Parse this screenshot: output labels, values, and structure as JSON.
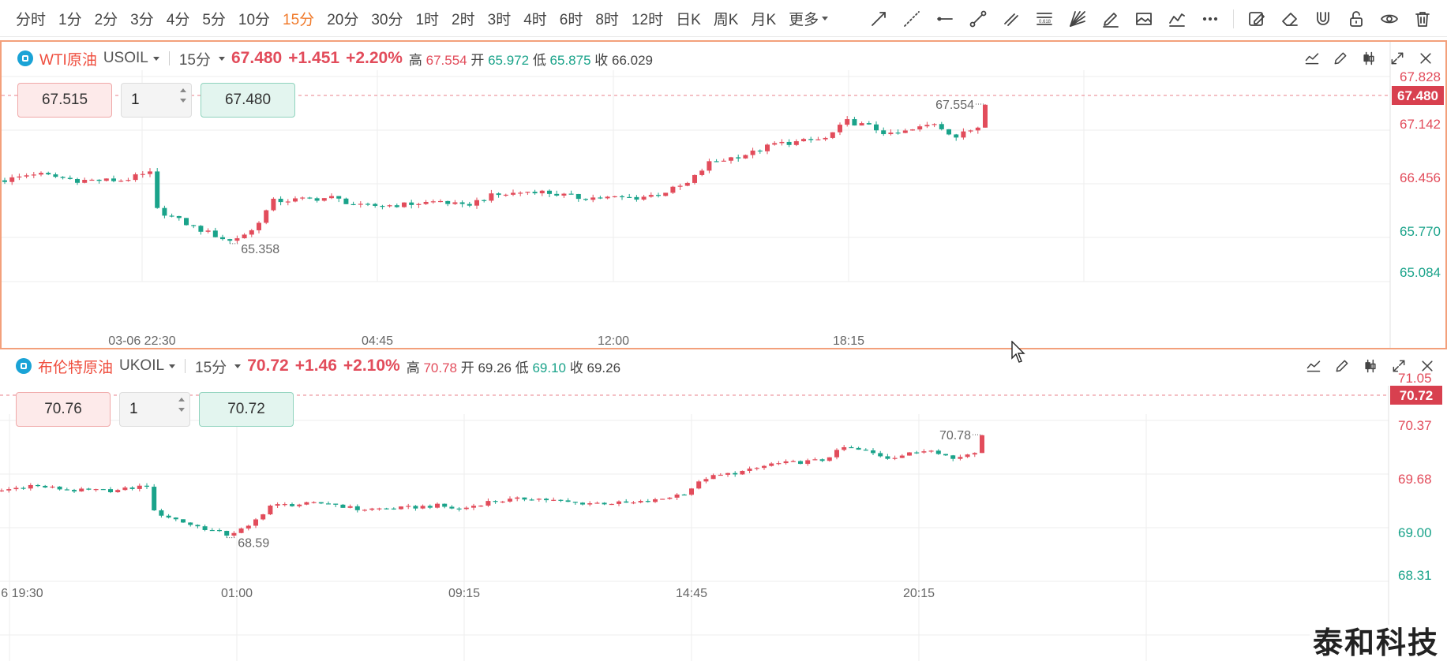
{
  "toolbar": {
    "periods": [
      "分时",
      "1分",
      "2分",
      "3分",
      "4分",
      "5分",
      "10分",
      "15分",
      "20分",
      "30分",
      "1时",
      "2时",
      "3时",
      "4时",
      "6时",
      "8时",
      "12时",
      "日K",
      "周K",
      "月K"
    ],
    "active_period": "15分",
    "more_label": "更多",
    "tools": [
      "trend-line-icon",
      "extended-line-icon",
      "horizontal-line-icon",
      "segment-icon",
      "parallel-channel-icon",
      "fibonacci-icon",
      "gann-fan-icon",
      "brush-icon",
      "image-icon",
      "polyline-icon",
      "more-tools-icon",
      "note-icon",
      "eraser-icon",
      "magnet-icon",
      "lock-icon",
      "eye-icon",
      "trash-icon"
    ]
  },
  "panes": [
    {
      "name": "WTI原油",
      "code": "USOIL",
      "interval": "15分",
      "last": "67.480",
      "change": "+1.451",
      "change_pct": "+2.20%",
      "high_label": "高",
      "high": "67.554",
      "open_label": "开",
      "open": "65.972",
      "low_label": "低",
      "low": "65.875",
      "close_label": "收",
      "close": "66.029",
      "sell_price": "67.515",
      "quantity": "1",
      "buy_price": "67.480",
      "y_ticks": [
        "67.828",
        "67.142",
        "66.456",
        "65.770",
        "65.084"
      ],
      "x_ticks": [
        "03-06 22:30",
        "04:45",
        "12:00",
        "18:15"
      ],
      "price_tag": "67.480",
      "max_label": "67.554",
      "min_label": "65.358"
    },
    {
      "name": "布伦特原油",
      "code": "UKOIL",
      "interval": "15分",
      "last": "70.72",
      "change": "+1.46",
      "change_pct": "+2.10%",
      "high_label": "高",
      "high": "70.78",
      "open_label": "开",
      "open": "69.26",
      "low_label": "低",
      "low": "69.10",
      "close_label": "收",
      "close": "69.26",
      "sell_price": "70.76",
      "quantity": "1",
      "buy_price": "70.72",
      "y_ticks": [
        "71.05",
        "70.37",
        "69.68",
        "69.00",
        "68.31"
      ],
      "x_ticks": [
        "6 19:30",
        "01:00",
        "09:15",
        "14:45",
        "20:15"
      ],
      "price_tag": "70.72",
      "max_label": "70.78",
      "min_label": "68.59"
    }
  ],
  "watermark": "泰和科技",
  "colors": {
    "up": "#e24c5b",
    "down": "#1aa38a",
    "active": "#f07a2b"
  }
}
